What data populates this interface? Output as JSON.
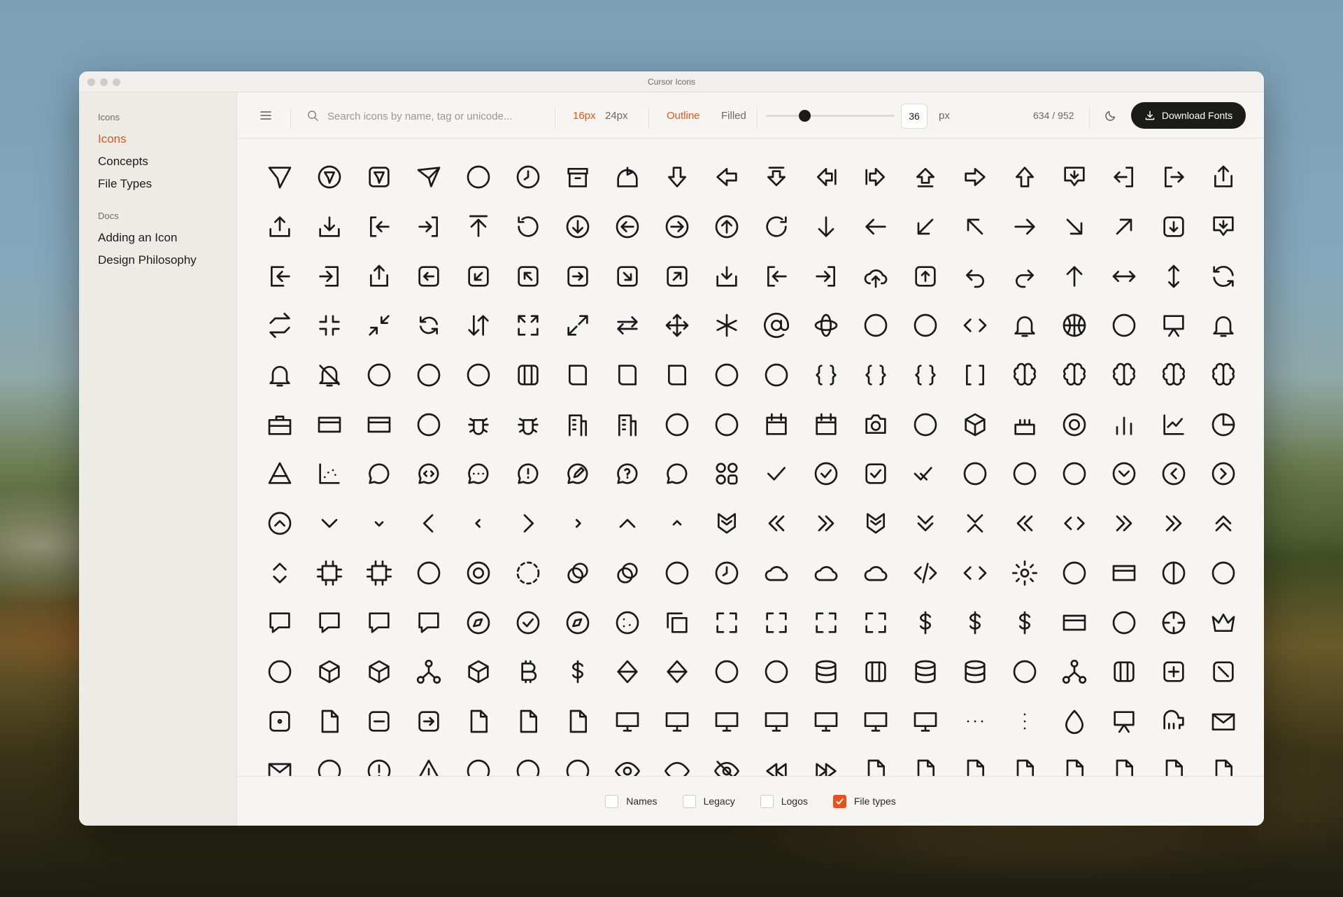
{
  "window": {
    "title": "Cursor Icons"
  },
  "sidebar": {
    "groups": [
      {
        "heading": "Icons",
        "items": [
          {
            "label": "Icons",
            "active": true
          },
          {
            "label": "Concepts"
          },
          {
            "label": "File Types"
          }
        ]
      },
      {
        "heading": "Docs",
        "items": [
          {
            "label": "Adding an Icon"
          },
          {
            "label": "Design Philosophy"
          }
        ]
      }
    ]
  },
  "toolbar": {
    "search_placeholder": "Search icons by name, tag or unicode...",
    "sizes": [
      "16px",
      "24px"
    ],
    "size_selected": "16px",
    "styles": [
      "Outline",
      "Filled"
    ],
    "style_selected": "Outline",
    "size_value": "36",
    "size_unit": "px",
    "count": "634 / 952",
    "download_label": "Download Fonts",
    "accent_color": "#e5531d"
  },
  "icons": [
    "send-icon",
    "send-circle-icon",
    "send-square-icon",
    "send-fast-icon",
    "sparkles-icon",
    "alarm-clock-icon",
    "archive-icon",
    "home-flag-icon",
    "arrow-down-bold-icon",
    "arrow-left-bold-icon",
    "arrow-down-bar-icon",
    "arrow-left-bar-icon",
    "arrow-right-bar-icon",
    "arrow-up-bar-icon",
    "arrow-right-bold-icon",
    "arrow-up-bold-icon",
    "arrow-down-tray-icon",
    "exit-left-icon",
    "exit-right-icon",
    "share-up-icon",
    "upload-icon",
    "download-icon",
    "login-left-icon",
    "login-right-icon",
    "arrow-up-from-line-icon",
    "undo-circle-icon",
    "arrow-down-circle-icon",
    "arrow-left-circle-icon",
    "arrow-right-circle-icon",
    "arrow-up-circle-icon",
    "redo-circle-icon",
    "arrow-down-icon",
    "arrow-left-icon",
    "arrow-down-left-icon",
    "arrow-up-left-icon",
    "arrow-right-icon",
    "arrow-down-right-icon",
    "arrow-up-right-icon",
    "arrow-down-square-icon",
    "arrow-down-chat-icon",
    "logout-left-icon",
    "logout-right-icon",
    "share-icon",
    "arrow-left-square-icon",
    "arrow-down-left-square-icon",
    "arrow-up-left-square-icon",
    "arrow-right-square-icon",
    "arrow-down-right-square-icon",
    "arrow-up-right-square-icon",
    "inbox-download-icon",
    "import-left-icon",
    "import-right-icon",
    "cloud-up-icon",
    "arrow-up-square-icon",
    "undo-icon",
    "redo-icon",
    "arrow-up-thin-icon",
    "arrows-horizontal-icon",
    "arrows-vertical-icon",
    "refresh-icon",
    "repeat-icon",
    "shrink-icon",
    "minimize-icon",
    "sync-icon",
    "arrows-up-down-icon",
    "expand-icon",
    "maximize-icon",
    "arrows-left-right-icon",
    "move-icon",
    "asterisk-icon",
    "at-sign-icon",
    "atom-icon",
    "bandage-icon",
    "banknote-icon",
    "barcode-icon",
    "dumbbell-icon",
    "basketball-icon",
    "badminton-icon",
    "easel-icon",
    "bell-icon",
    "bell-dot-icon",
    "bell-off-icon",
    "binary-icon",
    "binoculars-icon",
    "bluetooth-icon",
    "kanban-icon",
    "book-icon",
    "book-open-icon",
    "bookmark-icon",
    "library-icon",
    "bow-tie-icon",
    "braces-icon",
    "braces-dot-icon",
    "braces-x-icon",
    "brackets-icon",
    "brain-icon",
    "brain-cog-icon",
    "brain-left-icon",
    "brain-right-icon",
    "brain-off-icon",
    "briefcase-icon",
    "credit-card-icon",
    "cards-icon",
    "brush-icon",
    "bug-icon",
    "bug-off-icon",
    "building-icon",
    "buildings-icon",
    "target-arrow-icon",
    "calculator-icon",
    "calendar-icon",
    "calendar-x-icon",
    "camera-icon",
    "car-icon",
    "inbox-icon",
    "cake-icon",
    "record-icon",
    "bar-chart-icon",
    "line-chart-icon",
    "pie-chart-icon",
    "pyramid-icon",
    "scatter-chart-icon",
    "chat-bubble-icon",
    "chat-code-icon",
    "chat-dots-icon",
    "chat-alert-icon",
    "chat-edit-icon",
    "chat-question-icon",
    "chat-shapes-icon",
    "shapes-icon",
    "check-icon",
    "check-circle-icon",
    "check-square-icon",
    "check-double-icon",
    "chef-hat-icon",
    "chess-king-icon",
    "chess-rook-icon",
    "chevron-down-circle-icon",
    "chevron-left-circle-icon",
    "chevron-right-circle-icon",
    "chevron-up-circle-icon",
    "chevron-down-icon",
    "chevron-down-small-icon",
    "chevron-left-icon",
    "chevron-left-small-icon",
    "chevron-right-icon",
    "chevron-right-small-icon",
    "chevron-up-icon",
    "chevron-up-small-icon",
    "chevron-shield-icon",
    "chevrons-left-bold-icon",
    "chevrons-right-bold-icon",
    "chevrons-up-shield-icon",
    "chevrons-down-icon",
    "chevrons-collapse-icon",
    "chevrons-left-icon",
    "chevrons-horizontal-icon",
    "chevrons-right-icon",
    "chevrons-right-dashed-icon",
    "chevrons-up-icon",
    "chevrons-vertical-icon",
    "cpu-icon",
    "chip-icon",
    "circle-icon",
    "circle-dot-icon",
    "circle-dashed-icon",
    "circles-icon",
    "circles-check-icon",
    "clipboard-icon",
    "clock-icon",
    "cloud-icon",
    "cloud-download-icon",
    "cloud-upload-icon",
    "code-slash-icon",
    "code-icon",
    "gear-icon",
    "bowl-icon",
    "card-add-icon",
    "contrast-icon",
    "command-icon",
    "comment-icon",
    "comment-dashed-icon",
    "comment-dot-icon",
    "comments-icon",
    "compass-icon",
    "compass-check-icon",
    "compass-dot-icon",
    "cookie-icon",
    "copy-icon",
    "focus-icon",
    "frame-icon",
    "scan-check-icon",
    "scan-sparkle-icon",
    "dollars-three-icon",
    "dollar-sign-icon",
    "dollars-two-icon",
    "card-icon",
    "plus-bold-icon",
    "crosshair-icon",
    "crown-icon",
    "crystal-ball-icon",
    "cube-icon",
    "cube-alt-icon",
    "share-nodes-icon",
    "box-grid-icon",
    "bitcoin-icon",
    "dollar-icon",
    "diamond-icon",
    "gem-icon",
    "text-cursor-icon",
    "cutlery-icon",
    "database-icon",
    "layout-icon",
    "database-stack-icon",
    "database-disk-icon",
    "umbrella-table-icon",
    "sitemap-icon",
    "columns-icon",
    "plus-square-icon",
    "diagonal-square-icon",
    "dot-square-icon",
    "files-plus-icon",
    "minus-square-icon",
    "arrow-in-square-icon",
    "file-plus-icon",
    "file-arrow-icon",
    "file-add-icon",
    "monitor-icon",
    "monitor-check-icon",
    "monitor-user-icon",
    "monitor-x-icon",
    "monitor-play-icon",
    "monitor-cast-icon",
    "monitors-icon",
    "more-horizontal-icon",
    "more-vertical-icon",
    "droplet-icon",
    "presentation-icon",
    "elephant-icon",
    "mail-icon",
    "mail-open-icon",
    "eraser-icon",
    "alert-circle-icon",
    "alert-triangle-icon",
    "arrow-lines-icon",
    "arrows-right-icon",
    "extensions-icon",
    "eye-icon",
    "eye-closed-icon",
    "eye-off-icon",
    "rewind-icon",
    "fast-forward-icon",
    "file-icon",
    "file-share-icon",
    "file-code-icon",
    "file-image-icon",
    "file-text-icon",
    "file-lock-icon",
    "file-pdf-icon",
    "file-add-alt-icon"
  ],
  "footer": {
    "checkboxes": [
      {
        "label": "Names",
        "checked": false
      },
      {
        "label": "Legacy",
        "checked": false
      },
      {
        "label": "Logos",
        "checked": false
      },
      {
        "label": "File types",
        "checked": true
      }
    ]
  }
}
